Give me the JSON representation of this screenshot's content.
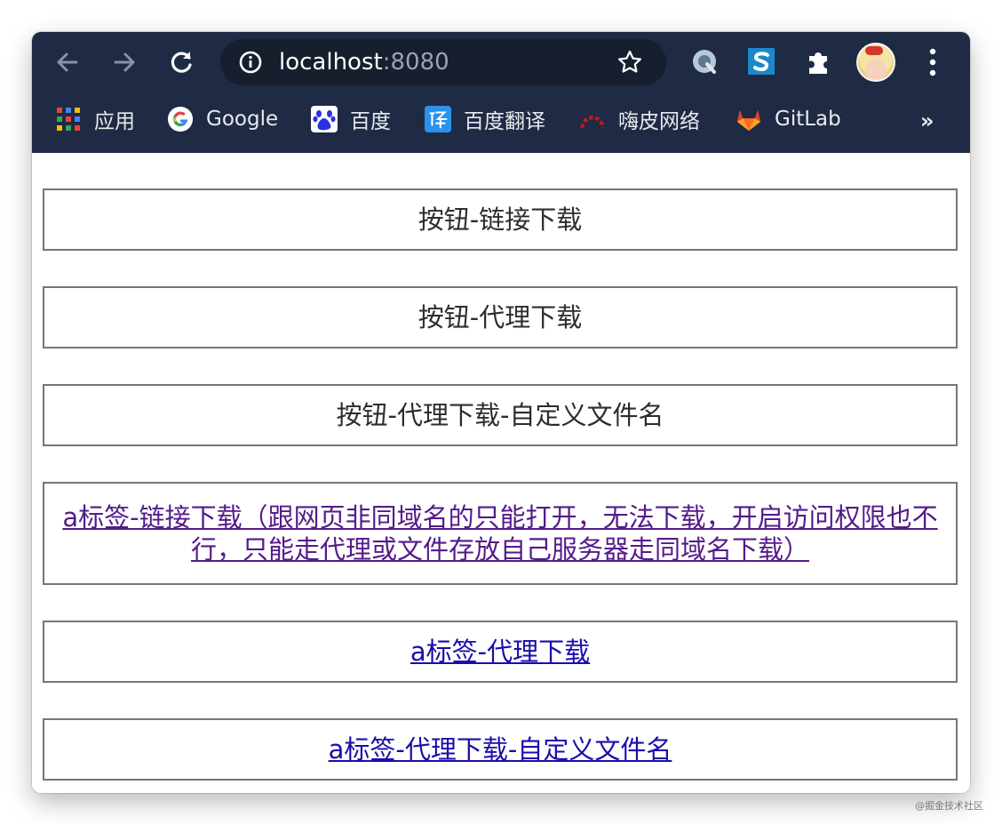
{
  "browser": {
    "url_host": "localhost",
    "url_port": ":8080"
  },
  "bookmarks": [
    {
      "label": "应用",
      "icon": "apps-grid-icon"
    },
    {
      "label": "Google",
      "icon": "google-icon"
    },
    {
      "label": "百度",
      "icon": "baidu-icon"
    },
    {
      "label": "百度翻译",
      "icon": "baidu-translate-icon"
    },
    {
      "label": "嗨皮网络",
      "icon": "happy-network-icon"
    },
    {
      "label": "GitLab",
      "icon": "gitlab-icon"
    }
  ],
  "bookmarks_more": "»",
  "content": {
    "buttons": [
      {
        "label": "按钮-链接下载",
        "kind": "button"
      },
      {
        "label": "按钮-代理下载",
        "kind": "button"
      },
      {
        "label": "按钮-代理下载-自定义文件名",
        "kind": "button"
      },
      {
        "label": "a标签-链接下载（跟网页非同域名的只能打开，无法下载，开启访问权限也不行，只能走代理或文件存放自己服务器走同域名下载）",
        "kind": "link-visited"
      },
      {
        "label": "a标签-代理下载",
        "kind": "link"
      },
      {
        "label": "a标签-代理下载-自定义文件名",
        "kind": "link"
      }
    ]
  },
  "watermark": "@掘金技术社区",
  "colors": {
    "toolbar_bg": "#1f2a44",
    "omnibox_bg": "#171e2e",
    "link": "#1a0dab",
    "link_visited": "#551a8b",
    "button_border": "#767676"
  }
}
